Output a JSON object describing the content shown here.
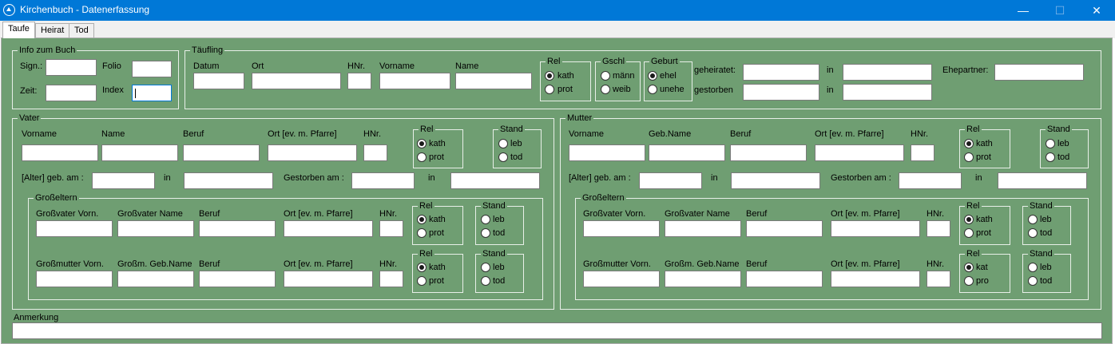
{
  "window": {
    "title": "Kirchenbuch - Datenerfassung",
    "minimize": "—",
    "maximize": "☐",
    "close": "✕"
  },
  "tabs": [
    "Taufe",
    "Heirat",
    "Tod"
  ],
  "info": {
    "title": "Info zum Buch",
    "sign": "Sign.:",
    "folio": "Folio",
    "zeit": "Zeit:",
    "index": "Index"
  },
  "taeufling": {
    "title": "Täufling",
    "datum": "Datum",
    "ort": "Ort",
    "hnr": "HNr.",
    "vorname": "Vorname",
    "name": "Name",
    "rel": "Rel",
    "kath": "kath",
    "prot": "prot",
    "gschl": "Gschl",
    "maenn": "männ",
    "weib": "weib",
    "geburt": "Geburt",
    "ehel": "ehel",
    "unehe": "unehe",
    "geheiratet": "geheiratet:",
    "gestorben": "gestorben",
    "in1": "in",
    "in2": "in",
    "ehepartner": "Ehepartner:"
  },
  "vater": {
    "title": "Vater",
    "vorname": "Vorname",
    "name": "Name",
    "beruf": "Beruf",
    "ort": "Ort [ev. m. Pfarre]",
    "hnr": "HNr.",
    "rel": "Rel",
    "kath": "kath",
    "prot": "prot",
    "stand": "Stand",
    "leb": "leb",
    "tod": "tod",
    "alter": "[Alter] geb. am :",
    "in1": "in",
    "gestorben": "Gestorben am :",
    "in2": "in",
    "grosseltern": {
      "title": "Großeltern",
      "gv_vorn": "Großvater Vorn.",
      "gv_name": "Großvater Name",
      "gv_beruf": "Beruf",
      "gv_ort": "Ort [ev. m. Pfarre]",
      "gv_hnr": "HNr.",
      "gv_rel": "Rel",
      "gv_kath": "kath",
      "gv_prot": "prot",
      "gv_stand": "Stand",
      "gv_leb": "leb",
      "gv_tod": "tod",
      "gm_vorn": "Großmutter Vorn.",
      "gm_name": "Großm. Geb.Name",
      "gm_beruf": "Beruf",
      "gm_ort": "Ort [ev. m. Pfarre]",
      "gm_hnr": "HNr.",
      "gm_rel": "Rel",
      "gm_kath": "kath",
      "gm_prot": "prot",
      "gm_stand": "Stand",
      "gm_leb": "leb",
      "gm_tod": "tod"
    }
  },
  "mutter": {
    "title": "Mutter",
    "vorname": "Vorname",
    "name": "Geb.Name",
    "beruf": "Beruf",
    "ort": "Ort [ev. m. Pfarre]",
    "hnr": "HNr.",
    "rel": "Rel",
    "kath": "kath",
    "prot": "prot",
    "stand": "Stand",
    "leb": "leb",
    "tod": "tod",
    "alter": "[Alter] geb. am :",
    "in1": "in",
    "gestorben": "Gestorben am :",
    "in2": "in",
    "grosseltern": {
      "title": "Großeltern",
      "gv_vorn": "Großvater Vorn.",
      "gv_name": "Großvater Name",
      "gv_beruf": "Beruf",
      "gv_ort": "Ort [ev. m. Pfarre]",
      "gv_hnr": "HNr.",
      "gv_rel": "Rel",
      "gv_kath": "kath",
      "gv_prot": "prot",
      "gv_stand": "Stand",
      "gv_leb": "leb",
      "gv_tod": "tod",
      "gm_vorn": "Großmutter Vorn.",
      "gm_name": "Großm. Geb.Name",
      "gm_beruf": "Beruf",
      "gm_ort": "Ort [ev. m. Pfarre]",
      "gm_hnr": "HNr.",
      "gm_rel": "Rel",
      "gm_kath": "kat",
      "gm_prot": "pro",
      "gm_stand": "Stand",
      "gm_leb": "leb",
      "gm_tod": "tod"
    }
  },
  "anmerkung": "Anmerkung",
  "colors": {
    "titlebar": "#0078d7",
    "panel": "#6f9e72",
    "groupbox_border": "#e8efe8"
  }
}
